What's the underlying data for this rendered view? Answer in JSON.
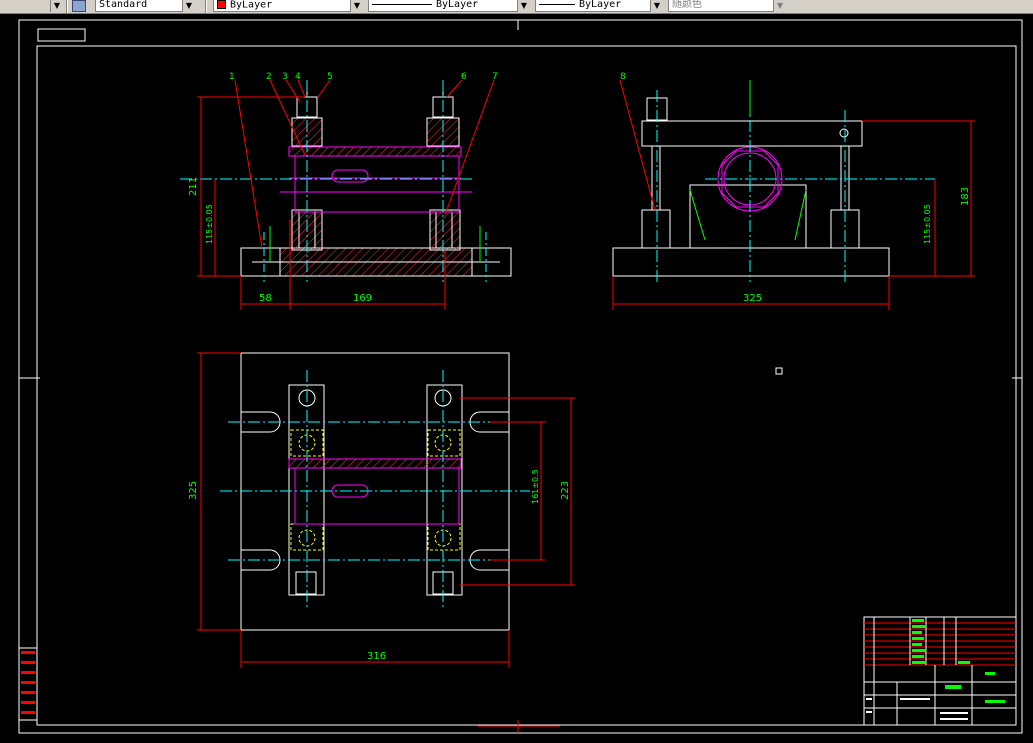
{
  "toolbar": {
    "text_style": "Standard",
    "color": "ByLayer",
    "color_swatch": "#ff0000",
    "linetype": "ByLayer",
    "lineweight": "ByLayer",
    "plot_style": "随颜色"
  },
  "colors": {
    "border": "#ffffff",
    "dimension": "#ff0000",
    "dim_text": "#00ff00",
    "shaft": "#ff00ff",
    "centerline": "#00ffff",
    "hidden": "#ffff00",
    "hatch": "#ff0000"
  },
  "front_view": {
    "balloons": [
      "1",
      "2",
      "3",
      "4",
      "5",
      "6",
      "7"
    ],
    "dim_height_total": "211",
    "dim_height_axis": "115±0.05",
    "dim_left": "58",
    "dim_span": "169"
  },
  "side_view": {
    "balloon": "8",
    "dim_width": "325",
    "dim_height_axis": "115±0.05",
    "dim_height_total": "183"
  },
  "top_view": {
    "dim_height": "325",
    "dim_width": "316",
    "dim_inner": "161±0.5",
    "dim_outer": "223"
  }
}
